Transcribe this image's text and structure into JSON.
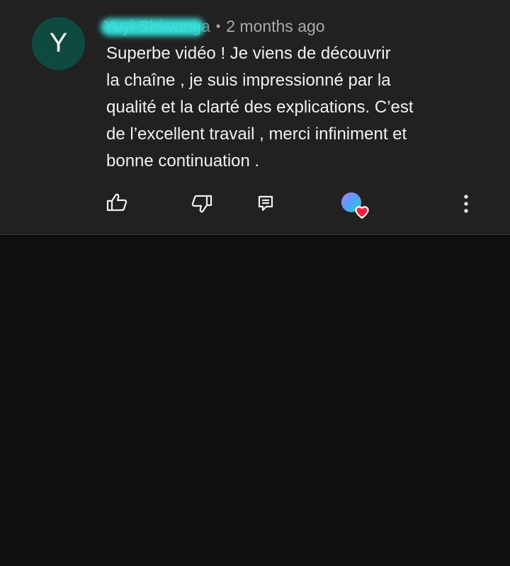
{
  "comment": {
    "avatar_letter": "Y",
    "author_name": "Yuyi Shiwanga",
    "separator": "•",
    "timestamp": "2 months ago",
    "text_lines": [
      "Superbe vidéo ! Je viens de découvrir",
      "la chaîne , je suis impressionné par la",
      "qualité et la clarté des explications. C’est",
      "de l’excellent travail , merci infiniment et",
      "bonne continuation ."
    ],
    "actions": {
      "like_icon": "thumbs-up-icon",
      "dislike_icon": "thumbs-down-icon",
      "reply_icon": "reply-comment-icon",
      "heart_icon": "creator-heart-icon",
      "more_icon": "more-vertical-icon"
    }
  },
  "colors": {
    "card_background": "#212121",
    "page_background": "#0f0f0f",
    "avatar_background": "#0e4a40",
    "redaction": "#35e3dc",
    "heart": "#ff1f3d"
  }
}
